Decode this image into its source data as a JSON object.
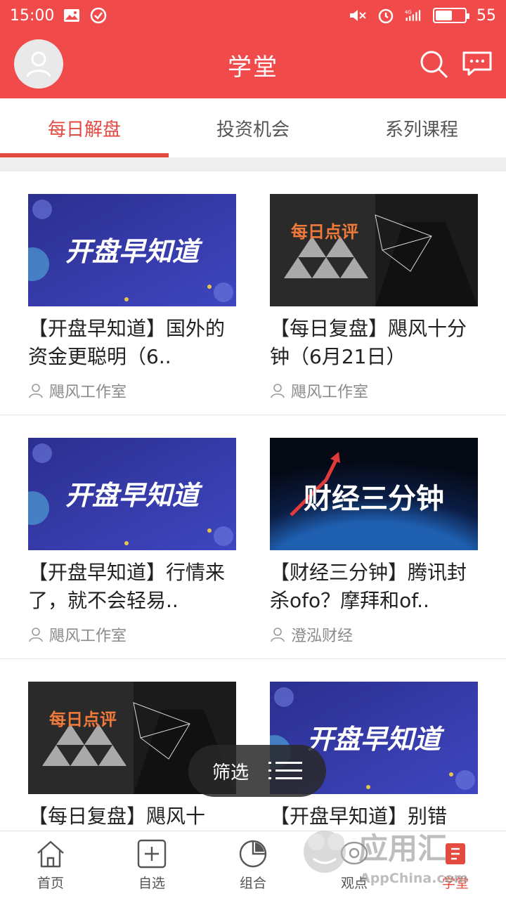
{
  "status_bar": {
    "time": "15:00",
    "battery": "55",
    "network": "4G"
  },
  "header": {
    "title": "学堂"
  },
  "tabs": [
    {
      "label": "每日解盘",
      "active": true
    },
    {
      "label": "投资机会",
      "active": false
    },
    {
      "label": "系列课程",
      "active": false
    }
  ],
  "cards": [
    {
      "title": "【开盘早知道】国外的资金更聪明（6..",
      "author": "飓风工作室",
      "thumb_text": "开盘早知道"
    },
    {
      "title": "【每日复盘】飓风十分钟（6月21日）",
      "author": "飓风工作室",
      "thumb_text": "每日点评"
    },
    {
      "title": "【开盘早知道】行情来了，就不会轻易..",
      "author": "飓风工作室",
      "thumb_text": "开盘早知道"
    },
    {
      "title": "【财经三分钟】腾讯封杀ofo？摩拜和of..",
      "author": "澄泓财经",
      "thumb_text": "财经三分钟"
    },
    {
      "title": "【每日复盘】飓风十",
      "author": "",
      "thumb_text": "每日点评"
    },
    {
      "title": "【开盘早知道】别错",
      "author": "",
      "thumb_text": "开盘早知道"
    }
  ],
  "filter": {
    "label": "筛选"
  },
  "bottom_nav": [
    {
      "label": "首页",
      "icon": "home-icon",
      "active": false
    },
    {
      "label": "自选",
      "icon": "plus-square-icon",
      "active": false
    },
    {
      "label": "组合",
      "icon": "pie-chart-icon",
      "active": false
    },
    {
      "label": "观点",
      "icon": "chat-icon",
      "active": false
    },
    {
      "label": "学堂",
      "icon": "school-icon",
      "active": true
    }
  ],
  "watermark": {
    "text": "应用汇",
    "sub": "AppChina.com"
  },
  "colors": {
    "brand": "#f04a4a",
    "accent": "#e34b41"
  }
}
